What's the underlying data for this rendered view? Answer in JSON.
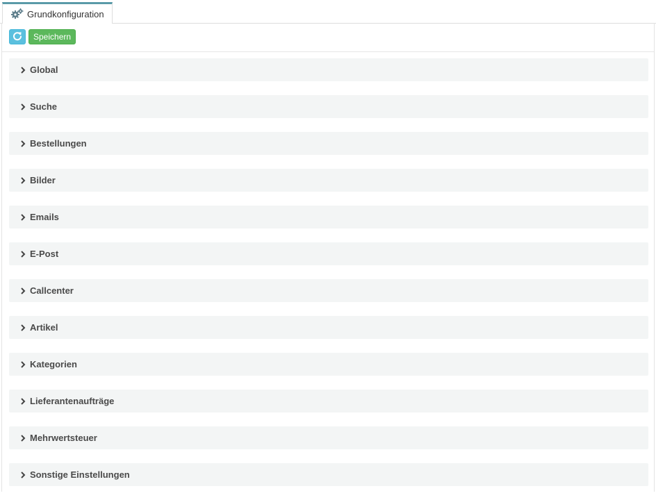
{
  "tab": {
    "title": "Grundkonfiguration",
    "icon": "gears-icon"
  },
  "toolbar": {
    "refresh_icon": "refresh-icon",
    "save_label": "Speichern"
  },
  "sections": [
    {
      "label": "Global"
    },
    {
      "label": "Suche"
    },
    {
      "label": "Bestellungen"
    },
    {
      "label": "Bilder"
    },
    {
      "label": "Emails"
    },
    {
      "label": "E-Post"
    },
    {
      "label": "Callcenter"
    },
    {
      "label": "Artikel"
    },
    {
      "label": "Kategorien"
    },
    {
      "label": "Lieferantenaufträge"
    },
    {
      "label": "Mehrwertsteuer"
    },
    {
      "label": "Sonstige Einstellungen"
    }
  ],
  "colors": {
    "tab_accent": "#5a9aa8",
    "refresh_button": "#5bc0de",
    "save_button": "#5cb85c",
    "section_background": "#f3f5f5"
  }
}
